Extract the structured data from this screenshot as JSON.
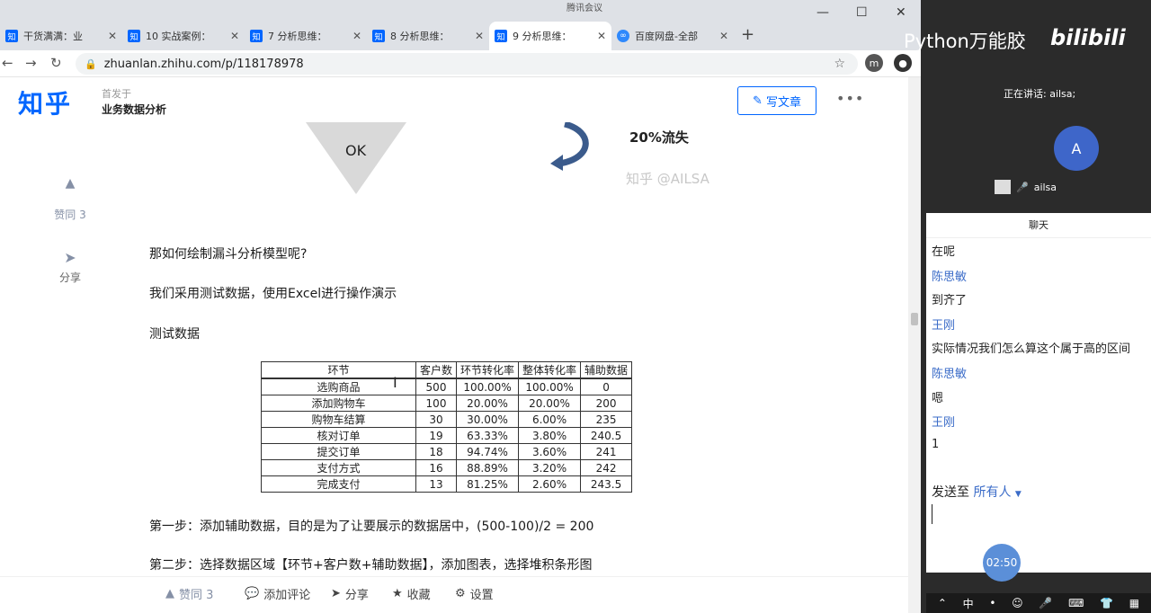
{
  "browser": {
    "meeting_title": "腾讯会议",
    "tabs": [
      {
        "favicon": "知",
        "title": "干货满满：业"
      },
      {
        "favicon": "知",
        "title": "10 实战案例："
      },
      {
        "favicon": "知",
        "title": "7 分析思维："
      },
      {
        "favicon": "知",
        "title": "8 分析思维："
      },
      {
        "favicon": "知",
        "title": "9 分析思维："
      },
      {
        "favicon": "∞",
        "title": "百度网盘-全部"
      }
    ],
    "active_tab": 4,
    "url": "zhuanlan.zhihu.com/p/118178978",
    "profile_initial": "m"
  },
  "header": {
    "logo": "知乎",
    "published_in": "首发于",
    "column": "业务数据分析",
    "write_button": "写文章",
    "more": "•••"
  },
  "sidebar": {
    "likes": "赞同 3",
    "share": "分享"
  },
  "article": {
    "ok_label": "OK",
    "loss_label": "20%流失",
    "watermark": "知乎 @AILSA",
    "question": "那如何绘制漏斗分析模型呢?",
    "intro": "我们采用测试数据，使用Excel进行操作演示",
    "test_data_title": "测试数据",
    "table": {
      "headers": [
        "环节",
        "客户数",
        "环节转化率",
        "整体转化率",
        "辅助数据"
      ],
      "rows": [
        [
          "选购商品",
          "500",
          "100.00%",
          "100.00%",
          "0"
        ],
        [
          "添加购物车",
          "100",
          "20.00%",
          "20.00%",
          "200"
        ],
        [
          "购物车结算",
          "30",
          "30.00%",
          "6.00%",
          "235"
        ],
        [
          "核对订单",
          "19",
          "63.33%",
          "3.80%",
          "240.5"
        ],
        [
          "提交订单",
          "18",
          "94.74%",
          "3.60%",
          "241"
        ],
        [
          "支付方式",
          "16",
          "88.89%",
          "3.20%",
          "242"
        ],
        [
          "完成支付",
          "13",
          "81.25%",
          "2.60%",
          "243.5"
        ]
      ]
    },
    "step1": "第一步：添加辅助数据，目的是为了让要展示的数据居中，(500-100)/2 = 200",
    "step2": "第二步：选择数据区域【环节+客户数+辅助数据】，添加图表，选择堆积条形图"
  },
  "actionbar": {
    "likes": "赞同 3",
    "comment": "添加评论",
    "share": "分享",
    "favorite": "收藏",
    "settings": "设置"
  },
  "meeting": {
    "stream_title": "Python万能胶",
    "platform": "bilibili",
    "speaking": "正在讲话: ailsa;",
    "avatar_initial": "A",
    "user_name": "ailsa",
    "chat_title": "聊天",
    "messages": [
      {
        "type": "text",
        "text": "在呢"
      },
      {
        "type": "name",
        "text": "陈思敏"
      },
      {
        "type": "text",
        "text": "到齐了"
      },
      {
        "type": "name",
        "text": "王刚"
      },
      {
        "type": "text",
        "text": "实际情况我们怎么算这个属于高的区间"
      },
      {
        "type": "name",
        "text": "陈思敏"
      },
      {
        "type": "text",
        "text": "嗯"
      },
      {
        "type": "name",
        "text": "王刚"
      },
      {
        "type": "text",
        "text": "1"
      }
    ],
    "send_to_label": "发送至",
    "send_to_target": "所有人",
    "timer": "02:50",
    "taskbar_ime": "中"
  }
}
